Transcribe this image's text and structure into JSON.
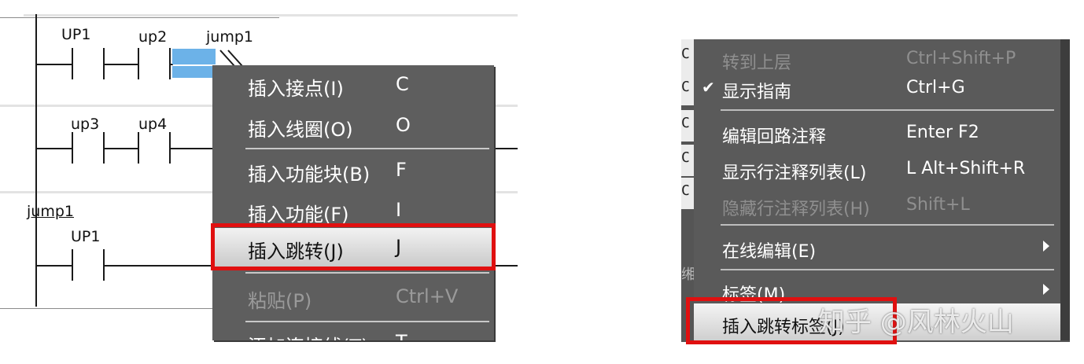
{
  "ladder": {
    "rung1_labels": [
      "UP1",
      "up2",
      "jump1"
    ],
    "rung2_labels": [
      "up3",
      "up4"
    ],
    "rung3_jump_label": "jump1",
    "rung3_contact_label": "UP1"
  },
  "context_menu_left": {
    "items": [
      {
        "label": "插入接点(I)",
        "shortcut": "C",
        "enabled": true
      },
      {
        "label": "插入线圈(O)",
        "shortcut": "O",
        "enabled": true
      },
      {
        "label": "插入功能块(B)",
        "shortcut": "F",
        "enabled": true
      },
      {
        "label": "插入功能(F)",
        "shortcut": "I",
        "enabled": true
      },
      {
        "label": "插入跳转(J)",
        "shortcut": "J",
        "enabled": true,
        "highlighted": true
      },
      {
        "label": "粘贴(P)",
        "shortcut": "Ctrl+V",
        "enabled": false
      },
      {
        "label": "添加连接线(T)",
        "shortcut": "T",
        "enabled": true
      }
    ]
  },
  "context_menu_right": {
    "items": [
      {
        "label": "转到上层",
        "shortcut": "Ctrl+Shift+P",
        "enabled": false
      },
      {
        "label": "显示指南",
        "shortcut": "Ctrl+G",
        "enabled": true,
        "checked": true
      },
      {
        "label": "编辑回路注释",
        "shortcut": "Enter F2",
        "enabled": true
      },
      {
        "label": "显示行注释列表(L)",
        "shortcut": "L Alt+Shift+R",
        "enabled": true
      },
      {
        "label": "隐藏行注释列表(H)",
        "shortcut": "Shift+L",
        "enabled": false
      },
      {
        "label": "在线编辑(E)",
        "shortcut": "",
        "enabled": true,
        "submenu": true
      },
      {
        "label": "标签(M)",
        "shortcut": "",
        "enabled": true,
        "submenu": true
      },
      {
        "label": "插入跳转标签(J)",
        "shortcut": "",
        "enabled": true,
        "highlighted": true
      }
    ],
    "edge_chars": [
      "C",
      "C",
      "C",
      "C",
      "C",
      "缃"
    ]
  },
  "watermark": "知乎 @风林火山",
  "colors": {
    "menu_bg": "#5e5e5e",
    "highlight_box": "#e01010",
    "selection": "#6cb2e8"
  }
}
